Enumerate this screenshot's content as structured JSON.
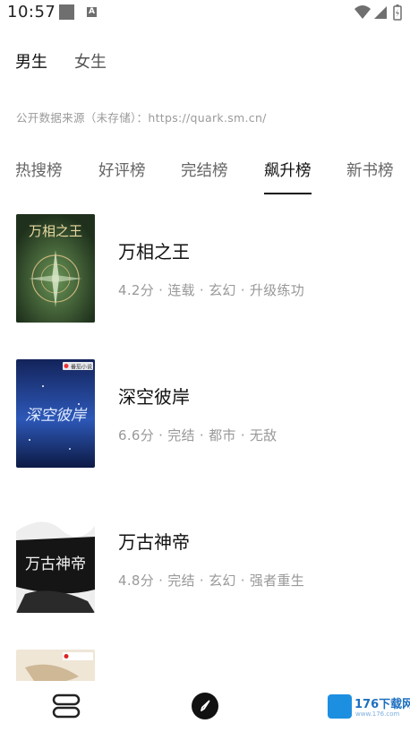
{
  "status_bar": {
    "time": "10:57",
    "icons": [
      "notification-square-icon",
      "a-badge-icon",
      "wifi-icon",
      "signal-icon",
      "battery-icon"
    ],
    "a_badge": "A"
  },
  "gender_tabs": [
    {
      "label": "男生",
      "active": true
    },
    {
      "label": "女生",
      "active": false
    }
  ],
  "source_note": "公开数据来源（未存储）：https://quark.sm.cn/",
  "rank_tabs": [
    {
      "label": "热搜榜",
      "active": false
    },
    {
      "label": "好评榜",
      "active": false
    },
    {
      "label": "完结榜",
      "active": false
    },
    {
      "label": "飙升榜",
      "active": true
    },
    {
      "label": "新书榜",
      "active": false
    }
  ],
  "books": [
    {
      "title": "万相之王",
      "meta": "4.2分 · 连载 · 玄幻 · 升级练功",
      "cover_text": "万相之王",
      "cover_color": "#2f4a2a"
    },
    {
      "title": "深空彼岸",
      "meta": "6.6分 · 完结 · 都市 · 无敌",
      "cover_text": "深空彼岸",
      "cover_color": "#1b2f6b",
      "cover_badge": "番茄小说"
    },
    {
      "title": "万古神帝",
      "meta": "4.8分 · 完结 · 玄幻 · 强者重生",
      "cover_text": "万古神帝",
      "cover_color": "#e6e6e6"
    }
  ],
  "bottom_nav": {
    "items": [
      "bookshelf-icon",
      "compass-icon"
    ],
    "watermark": "176下载网",
    "watermark_sub": "www.176.com"
  }
}
